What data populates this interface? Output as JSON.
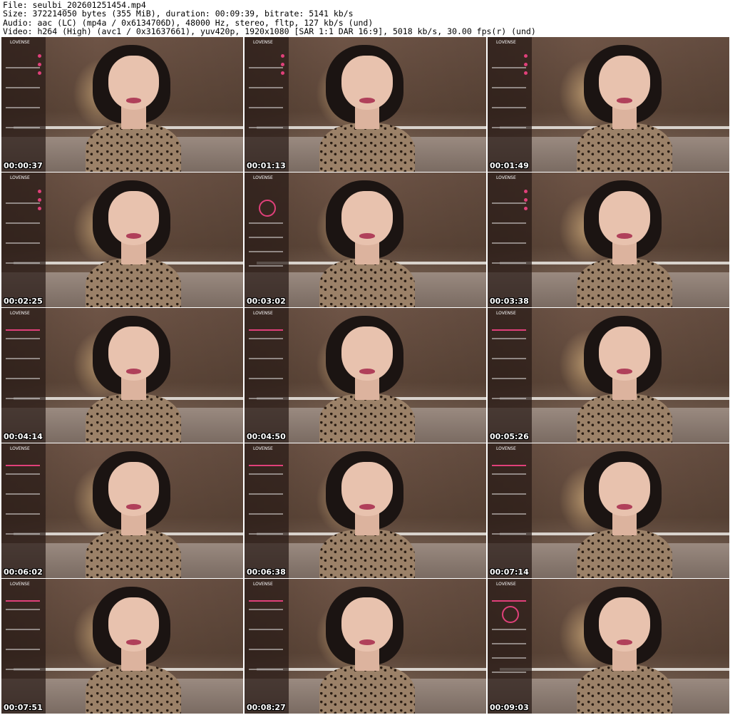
{
  "header": {
    "line1": "File: seulbi_202601251454.mp4",
    "line2": "Size: 372214050 bytes (355 MiB), duration: 00:09:39, bitrate: 5141 kb/s",
    "line3": "Audio: aac (LC) (mp4a / 0x6134706D), 48000 Hz, stereo, fltp, 127 kb/s (und)",
    "line4": "Video: h264 (High) (avc1 / 0x31637661), yuv420p, 1920x1080 [SAR 1:1 DAR 16:9], 5018 kb/s, 30.00 fps(r) (und)"
  },
  "overlay_logo": "LOVENSE",
  "thumbnails": [
    {
      "timestamp": "00:00:37"
    },
    {
      "timestamp": "00:01:13"
    },
    {
      "timestamp": "00:01:49"
    },
    {
      "timestamp": "00:02:25"
    },
    {
      "timestamp": "00:03:02"
    },
    {
      "timestamp": "00:03:38"
    },
    {
      "timestamp": "00:04:14"
    },
    {
      "timestamp": "00:04:50"
    },
    {
      "timestamp": "00:05:26"
    },
    {
      "timestamp": "00:06:02"
    },
    {
      "timestamp": "00:06:38"
    },
    {
      "timestamp": "00:07:14"
    },
    {
      "timestamp": "00:07:51"
    },
    {
      "timestamp": "00:08:27"
    },
    {
      "timestamp": "00:09:03"
    }
  ],
  "colors": {
    "overlay_accent": "#e0407a",
    "timestamp_text": "#ffffff"
  }
}
